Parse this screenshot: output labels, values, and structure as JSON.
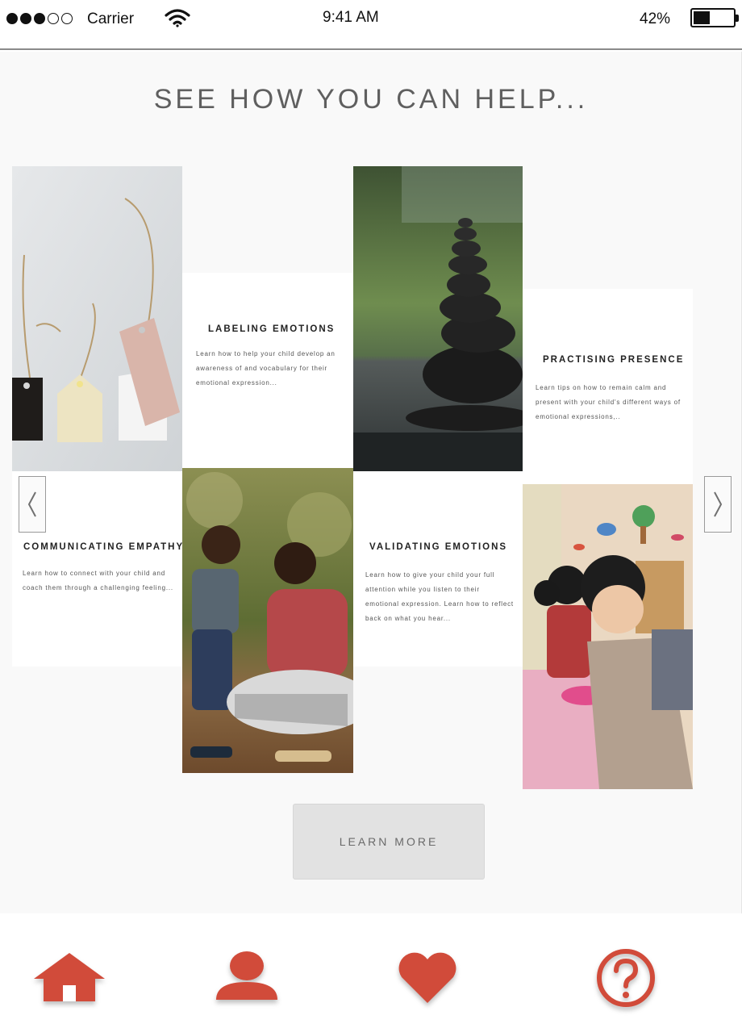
{
  "status_bar": {
    "carrier": "Carrier",
    "time": "9:41 AM",
    "battery": "42%",
    "battery_level": 0.42,
    "signal_bars_filled": 3,
    "signal_bars_total": 5
  },
  "page": {
    "title": "SEE HOW YOU CAN HELP..."
  },
  "cards": [
    {
      "title": "LABELING EMOTIONS",
      "description": "Learn how to help your child develop an awareness of and vocabulary for their emotional expression..."
    },
    {
      "title": "PRACTISING PRESENCE",
      "description": "Learn tips on how to remain calm and present with your child's different ways of emotional expressions,.."
    },
    {
      "title": "COMMUNICATING EMPATHY",
      "description": "Learn how to connect with your child and coach them through a challenging feeling..."
    },
    {
      "title": "VALIDATING EMOTIONS",
      "description": "Learn how to give your child your full attention while you listen to their emotional expression. Learn how to reflect back on what you hear..."
    }
  ],
  "photos": [
    {
      "name": "gift-tags-photo"
    },
    {
      "name": "stacked-stones-photo"
    },
    {
      "name": "mother-child-photo"
    },
    {
      "name": "classroom-child-photo"
    }
  ],
  "carousel": {
    "prev_icon": "chevron-left-icon",
    "next_icon": "chevron-right-icon"
  },
  "actions": {
    "learn_more": "LEARN MORE"
  },
  "tab_bar": {
    "accent_color": "#d14b3a",
    "tabs": [
      {
        "icon": "home-icon"
      },
      {
        "icon": "profile-icon"
      },
      {
        "icon": "heart-icon"
      },
      {
        "icon": "help-icon"
      }
    ]
  }
}
